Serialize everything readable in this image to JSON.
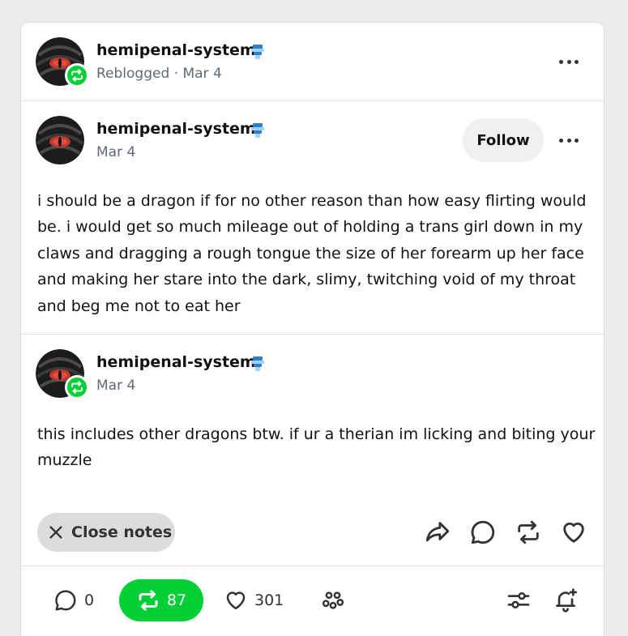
{
  "header": {
    "username": "hemipenal-system",
    "meta": "Reblogged · Mar 4"
  },
  "post": {
    "username": "hemipenal-system",
    "date": "Mar 4",
    "follow_label": "Follow",
    "text": "i should be a dragon if for no other reason than how easy flirting would be. i would get so much mileage out of holding a trans girl down in my claws and dragging a rough tongue the size of her forearm up her face and making her stare into the dark, slimy, twitching void of my throat and beg me not to eat her"
  },
  "reblog": {
    "username": "hemipenal-system",
    "date": "Mar 4",
    "text": "this includes other dragons btw. if ur a therian im licking and biting your muzzle"
  },
  "actions": {
    "close_notes_label": "Close notes"
  },
  "footer": {
    "replies": "0",
    "reblogs": "87",
    "likes": "301"
  },
  "colors": {
    "accent_green": "#00cf35",
    "muted_text": "#5e6a78"
  }
}
